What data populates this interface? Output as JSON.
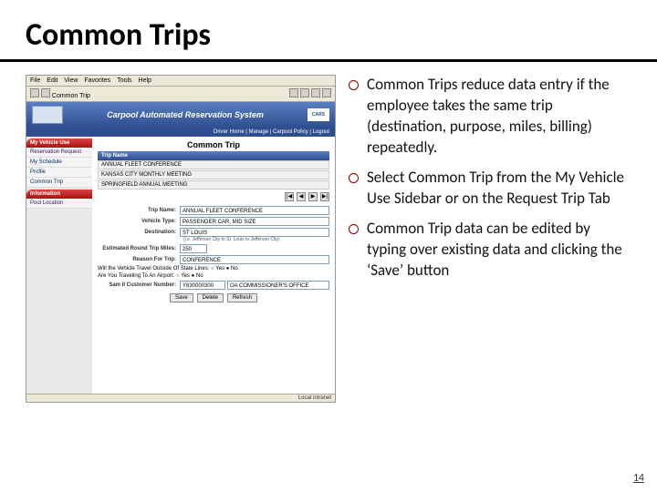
{
  "title": "Common Trips",
  "bullets": [
    "Common Trips reduce data entry if the employee takes the same trip (destination, purpose, miles, billing) repeatedly.",
    "Select Common Trip from the My Vehicle Use Sidebar or on the Request Trip Tab",
    "Common Trip data can be edited by typing over existing data and clicking the ‘Save’ button"
  ],
  "page_number": "14",
  "screenshot": {
    "menubar": [
      "File",
      "Edit",
      "View",
      "Favorites",
      "Tools",
      "Help"
    ],
    "tab_label": "Common Trip",
    "banner_title": "Carpool Automated Reservation System",
    "cars_badge": "CARS",
    "topnav": "Driver Home | Manage | Carpool Policy | Logout",
    "sidebar": {
      "hdr1": "My Vehicle Use",
      "items1": [
        "Reservation Request",
        "My Schedule",
        "Profile",
        "Common Trip"
      ],
      "hdr2": "Information",
      "items2": [
        "Pool Location"
      ]
    },
    "main_title": "Common Trip",
    "column_header": "Trip Name",
    "trips": [
      "ANNUAL FLEET CONFERENCE",
      "KANSAS CITY MONTHLY MEETING",
      "SPRINGFIELD ANNUAL MEETING"
    ],
    "pager": [
      "|◀",
      "◀",
      "▶",
      "▶|"
    ],
    "form": {
      "trip_name_label": "Trip Name:",
      "trip_name": "ANNUAL FLEET CONFERENCE",
      "vehicle_type_label": "Vehicle Type:",
      "vehicle_type": "PASSENGER CAR, MID SIZE",
      "destination_label": "Destination:",
      "destination": "ST LOUIS",
      "destination_hint": "(i.e. Jefferson City to St. Louis to Jefferson City)",
      "miles_label": "Estimated Round Trip Miles:",
      "miles": "250",
      "reason_label": "Reason For Trip:",
      "reason": "CONFERENCE",
      "out_of_state": "Will the Vehicle Travel Outside Of State Lines:  ○ Yes  ● No",
      "airport": "Are You Traveling To An Airport:  ○ Yes  ● No",
      "sam_label": "Sam II Customer Number:",
      "sam_num": "Y830000300",
      "sam_office": "OA COMMISSIONER'S OFFICE"
    },
    "buttons": [
      "Save",
      "Delete",
      "Refresh"
    ],
    "status_left": "",
    "status_right": "Local intranet"
  }
}
